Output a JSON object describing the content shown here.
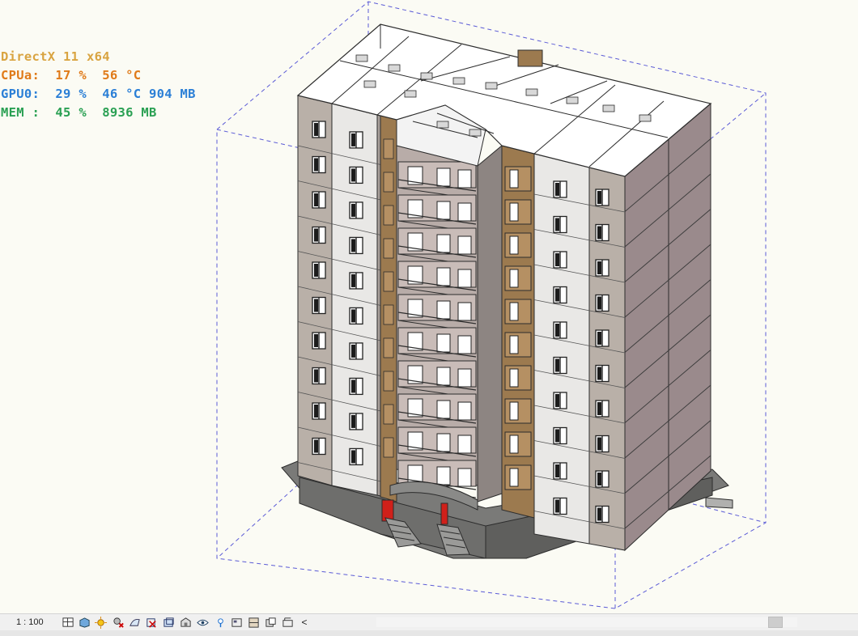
{
  "overlay": {
    "directx": {
      "text": "DirectX 11 x64",
      "color": "#d9a441"
    },
    "cpu": {
      "text": "CPUa:  17 %  56 °C",
      "color": "#e07b1a"
    },
    "gpu": {
      "text": "GPU0:  29 %  46 °C 904 MB",
      "color": "#2b7fd6"
    },
    "mem": {
      "text": "MEM :  45 %  8936 MB",
      "color": "#2aa053"
    }
  },
  "statusbar": {
    "scale": "1 : 100",
    "buttons": [
      "detail-level-icon",
      "visual-style-icon",
      "sun-path-icon",
      "shadows-icon",
      "render-icon",
      "crop-view-icon",
      "show-crop-region-icon",
      "lock-3d-view-icon",
      "temporary-hide-icon",
      "reveal-hidden-icon",
      "temporary-view-properties-icon",
      "analytical-model-icon",
      "highlight-displacement-icon",
      "reveal-constraints-icon"
    ],
    "collapse": "<"
  },
  "colors": {
    "background": "#fbfbf4",
    "section_box": "#5b5bd6",
    "wall_light": "#e9e8e6",
    "wall_taupe": "#b9b0a8",
    "wall_mauve": "#9a8a8c",
    "loggia_brown": "#9c7a4f",
    "base_grey": "#7a7a78",
    "door_red": "#d0201a"
  }
}
